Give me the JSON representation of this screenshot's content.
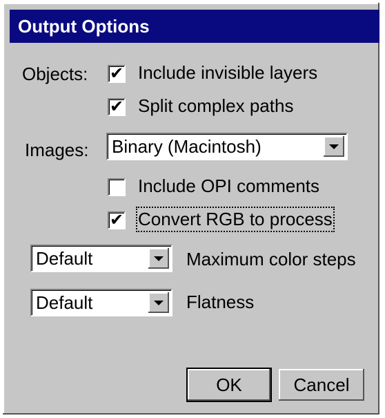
{
  "dialog": {
    "title": "Output Options",
    "objects_label": "Objects:",
    "include_invisible_layers": {
      "label": "Include invisible layers",
      "checked": true
    },
    "split_complex_paths": {
      "label": "Split complex paths",
      "checked": true
    },
    "images_label": "Images:",
    "images_select": {
      "value": "Binary (Macintosh)"
    },
    "include_opi_comments": {
      "label": "Include OPI comments",
      "checked": false
    },
    "convert_rgb_to_process": {
      "label": "Convert RGB to process",
      "checked": true
    },
    "max_color_steps": {
      "value": "Default",
      "label": "Maximum color steps"
    },
    "flatness": {
      "value": "Default",
      "label": "Flatness"
    },
    "ok_label": "OK",
    "cancel_label": "Cancel",
    "check_glyph": "✔"
  }
}
